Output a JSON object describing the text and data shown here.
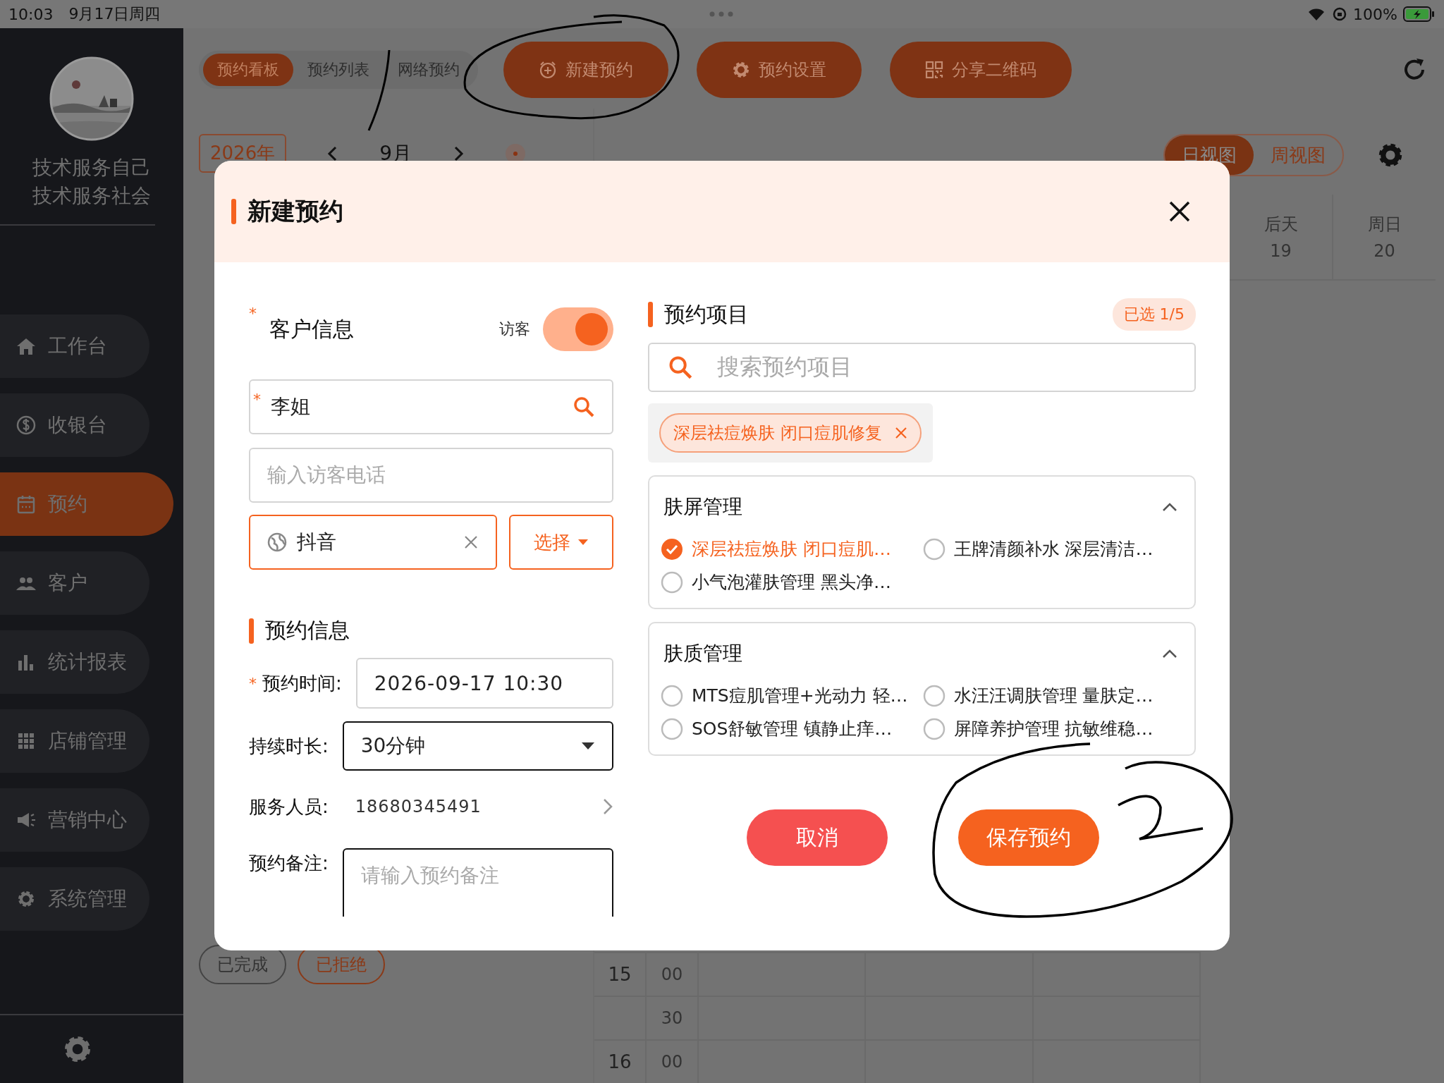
{
  "status_bar": {
    "time": "10:03",
    "date": "9月17日周四",
    "battery": "100%"
  },
  "sidebar": {
    "user_lines": [
      "技术服务自己",
      "技术服务社会"
    ],
    "items": [
      {
        "label": "工作台",
        "selected": false
      },
      {
        "label": "收银台",
        "selected": false
      },
      {
        "label": "预约",
        "selected": true
      },
      {
        "label": "客户",
        "selected": false
      },
      {
        "label": "统计报表",
        "selected": false
      },
      {
        "label": "店铺管理",
        "selected": false
      },
      {
        "label": "营销中心",
        "selected": false
      },
      {
        "label": "系统管理",
        "selected": false
      }
    ]
  },
  "top_tabs": [
    {
      "label": "预约看板",
      "selected": true
    },
    {
      "label": "预约列表",
      "selected": false
    },
    {
      "label": "网络预约",
      "selected": false
    }
  ],
  "toolbar_buttons": [
    "新建预约",
    "预约设置",
    "分享二维码"
  ],
  "calendar": {
    "year": "2026年",
    "month": "9月",
    "view_tabs": [
      {
        "label": "日视图",
        "selected": true
      },
      {
        "label": "周视图",
        "selected": false
      }
    ],
    "days": [
      {
        "name": "后天",
        "date": "19"
      },
      {
        "name": "周日",
        "date": "20"
      }
    ],
    "status_filters": [
      {
        "label": "已完成",
        "kind": "done"
      },
      {
        "label": "已拒绝",
        "kind": "rejected"
      }
    ],
    "time_rows": [
      {
        "hour": "15",
        "minute": "00"
      },
      {
        "minute": "30"
      },
      {
        "hour": "16",
        "minute": "00"
      }
    ]
  },
  "dialog": {
    "title": "新建预约",
    "customer": {
      "title_mark": "*",
      "title": "客户信息",
      "name_mark": "*",
      "visitor_label": "访客",
      "visitor_on": true,
      "name": "李姐",
      "phone_placeholder": "输入访客电话",
      "source": "抖音",
      "select_label": "选择"
    },
    "booking": {
      "title": "预约信息",
      "time_mark": "*",
      "time_label": "预约时间:",
      "time": "2026-09-17 10:30",
      "duration_label": "持续时长:",
      "duration": "30分钟",
      "staff_label": "服务人员:",
      "staff": "18680345491",
      "note_label": "预约备注:",
      "note_placeholder": "请输入预约备注"
    },
    "items": {
      "title": "预约项目",
      "count": "已选 1/5",
      "search_placeholder": "搜索预约项目",
      "selected_tags": [
        "深层祛痘焕肤 闭口痘肌修复"
      ],
      "groups": [
        {
          "name": "肤屏管理",
          "expanded": true,
          "options": [
            {
              "label": "深层祛痘焕肤 闭口痘肌…",
              "checked": true
            },
            {
              "label": "王牌清颜补水 深层清洁…",
              "checked": false
            },
            {
              "label": "小气泡灌肤管理 黑头净…",
              "checked": false
            }
          ]
        },
        {
          "name": "肤质管理",
          "expanded": true,
          "options": [
            {
              "label": "MTS痘肌管理+光动力 轻…",
              "checked": false
            },
            {
              "label": "水汪汪调肤管理 量肤定…",
              "checked": false
            },
            {
              "label": "SOS舒敏管理 镇静止痒…",
              "checked": false
            },
            {
              "label": "屏障养护管理 抗敏维稳…",
              "checked": false
            }
          ]
        }
      ]
    },
    "buttons": {
      "cancel": "取消",
      "save": "保存预约"
    }
  }
}
